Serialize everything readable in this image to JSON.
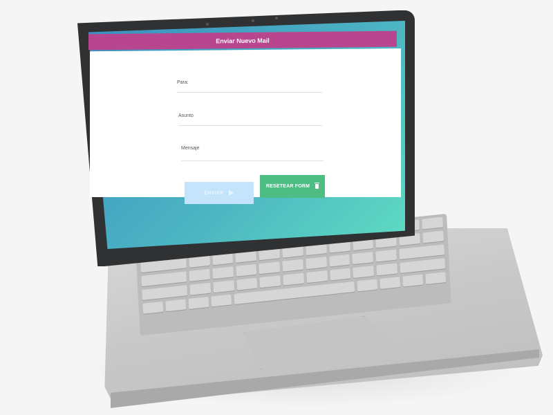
{
  "app": {
    "header_title": "Enviar Nuevo Mail"
  },
  "form": {
    "to_label": "Para:",
    "subject_label": "Asunto",
    "message_label": "Mensaje",
    "send_button": "ENVIAR",
    "reset_button": "RESETEAR FORM"
  },
  "icons": {
    "send": "send-arrow-icon",
    "reset": "trash-icon"
  },
  "colors": {
    "header": "#b7468e",
    "send_button": "#c4e4fb",
    "reset_button": "#4dbd84",
    "screen_gradient_start": "#3b8fc0",
    "screen_gradient_end": "#5fdcc2"
  }
}
